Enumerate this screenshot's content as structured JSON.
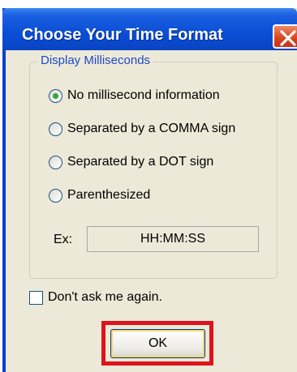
{
  "dialog": {
    "title": "Choose Your Time Format"
  },
  "group": {
    "legend": "Display Milliseconds",
    "options": [
      {
        "label": "No millisecond information",
        "checked": true
      },
      {
        "label": "Separated by a COMMA sign",
        "checked": false
      },
      {
        "label": "Separated by a DOT sign",
        "checked": false
      },
      {
        "label": "Parenthesized",
        "checked": false
      }
    ],
    "example_label": "Ex:",
    "example_value": "HH:MM:SS"
  },
  "dont_ask": {
    "label": "Don't ask me again.",
    "checked": false
  },
  "ok_label": "OK",
  "icons": {
    "close": "close-icon"
  },
  "colors": {
    "titlebar": "#0a4ed6",
    "close_button": "#d8431c",
    "legend_text": "#1f49c8",
    "highlight": "#e0121b",
    "dialog_bg": "#ece9d8"
  }
}
